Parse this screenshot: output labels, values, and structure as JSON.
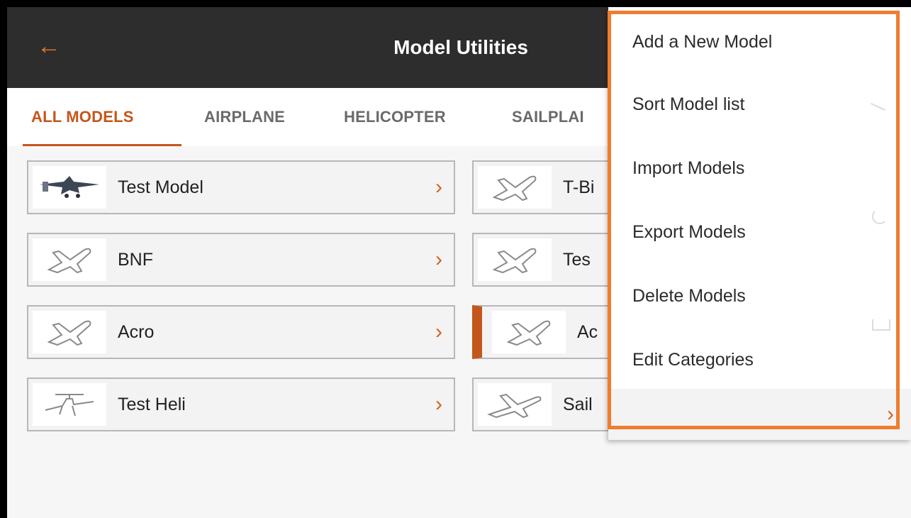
{
  "header": {
    "title": "Model Utilities",
    "back_icon": "arrow-left-icon",
    "back_glyph": "←"
  },
  "tabs": [
    {
      "label": "ALL MODELS",
      "active": true
    },
    {
      "label": "AIRPLANE",
      "active": false
    },
    {
      "label": "HELICOPTER",
      "active": false
    },
    {
      "label": "SAILPLAI",
      "active": false
    }
  ],
  "models": [
    {
      "label": "Test Model",
      "icon": "warplane-photo-icon"
    },
    {
      "label": "T-Bi",
      "icon": "airplane-outline-icon"
    },
    {
      "label": "BNF",
      "icon": "airplane-outline-icon"
    },
    {
      "label": "Tes",
      "icon": "airplane-outline-icon"
    },
    {
      "label": "Acro",
      "icon": "airplane-outline-icon"
    },
    {
      "label": "Ac",
      "icon": "airplane-outline-icon",
      "selected": true
    },
    {
      "label": "Test Heli",
      "icon": "helicopter-outline-icon"
    },
    {
      "label": "Sail",
      "icon": "sailplane-outline-icon"
    }
  ],
  "chevron_glyph": "›",
  "menu": {
    "items": [
      "Add a New Model",
      "Sort Model list",
      "Import Models",
      "Export Models",
      "Delete Models",
      "Edit Categories"
    ],
    "more_glyph": "›"
  },
  "colors": {
    "accent": "#c4561b",
    "highlight": "#ef7d2f",
    "header_bg": "#2d2d2d"
  }
}
